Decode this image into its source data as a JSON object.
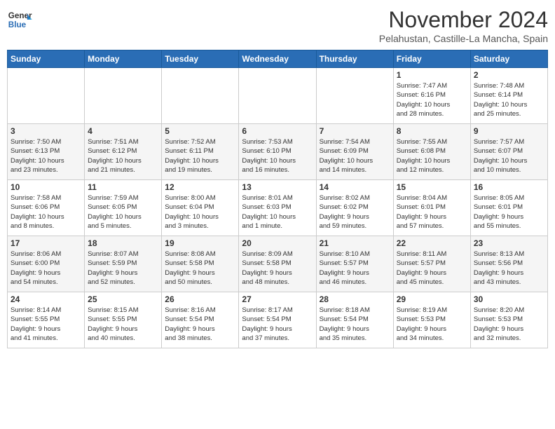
{
  "header": {
    "logo_line1": "General",
    "logo_line2": "Blue",
    "month": "November 2024",
    "location": "Pelahustan, Castille-La Mancha, Spain"
  },
  "weekdays": [
    "Sunday",
    "Monday",
    "Tuesday",
    "Wednesday",
    "Thursday",
    "Friday",
    "Saturday"
  ],
  "weeks": [
    [
      {
        "day": "",
        "info": ""
      },
      {
        "day": "",
        "info": ""
      },
      {
        "day": "",
        "info": ""
      },
      {
        "day": "",
        "info": ""
      },
      {
        "day": "",
        "info": ""
      },
      {
        "day": "1",
        "info": "Sunrise: 7:47 AM\nSunset: 6:16 PM\nDaylight: 10 hours\nand 28 minutes."
      },
      {
        "day": "2",
        "info": "Sunrise: 7:48 AM\nSunset: 6:14 PM\nDaylight: 10 hours\nand 25 minutes."
      }
    ],
    [
      {
        "day": "3",
        "info": "Sunrise: 7:50 AM\nSunset: 6:13 PM\nDaylight: 10 hours\nand 23 minutes."
      },
      {
        "day": "4",
        "info": "Sunrise: 7:51 AM\nSunset: 6:12 PM\nDaylight: 10 hours\nand 21 minutes."
      },
      {
        "day": "5",
        "info": "Sunrise: 7:52 AM\nSunset: 6:11 PM\nDaylight: 10 hours\nand 19 minutes."
      },
      {
        "day": "6",
        "info": "Sunrise: 7:53 AM\nSunset: 6:10 PM\nDaylight: 10 hours\nand 16 minutes."
      },
      {
        "day": "7",
        "info": "Sunrise: 7:54 AM\nSunset: 6:09 PM\nDaylight: 10 hours\nand 14 minutes."
      },
      {
        "day": "8",
        "info": "Sunrise: 7:55 AM\nSunset: 6:08 PM\nDaylight: 10 hours\nand 12 minutes."
      },
      {
        "day": "9",
        "info": "Sunrise: 7:57 AM\nSunset: 6:07 PM\nDaylight: 10 hours\nand 10 minutes."
      }
    ],
    [
      {
        "day": "10",
        "info": "Sunrise: 7:58 AM\nSunset: 6:06 PM\nDaylight: 10 hours\nand 8 minutes."
      },
      {
        "day": "11",
        "info": "Sunrise: 7:59 AM\nSunset: 6:05 PM\nDaylight: 10 hours\nand 5 minutes."
      },
      {
        "day": "12",
        "info": "Sunrise: 8:00 AM\nSunset: 6:04 PM\nDaylight: 10 hours\nand 3 minutes."
      },
      {
        "day": "13",
        "info": "Sunrise: 8:01 AM\nSunset: 6:03 PM\nDaylight: 10 hours\nand 1 minute."
      },
      {
        "day": "14",
        "info": "Sunrise: 8:02 AM\nSunset: 6:02 PM\nDaylight: 9 hours\nand 59 minutes."
      },
      {
        "day": "15",
        "info": "Sunrise: 8:04 AM\nSunset: 6:01 PM\nDaylight: 9 hours\nand 57 minutes."
      },
      {
        "day": "16",
        "info": "Sunrise: 8:05 AM\nSunset: 6:01 PM\nDaylight: 9 hours\nand 55 minutes."
      }
    ],
    [
      {
        "day": "17",
        "info": "Sunrise: 8:06 AM\nSunset: 6:00 PM\nDaylight: 9 hours\nand 54 minutes."
      },
      {
        "day": "18",
        "info": "Sunrise: 8:07 AM\nSunset: 5:59 PM\nDaylight: 9 hours\nand 52 minutes."
      },
      {
        "day": "19",
        "info": "Sunrise: 8:08 AM\nSunset: 5:58 PM\nDaylight: 9 hours\nand 50 minutes."
      },
      {
        "day": "20",
        "info": "Sunrise: 8:09 AM\nSunset: 5:58 PM\nDaylight: 9 hours\nand 48 minutes."
      },
      {
        "day": "21",
        "info": "Sunrise: 8:10 AM\nSunset: 5:57 PM\nDaylight: 9 hours\nand 46 minutes."
      },
      {
        "day": "22",
        "info": "Sunrise: 8:11 AM\nSunset: 5:57 PM\nDaylight: 9 hours\nand 45 minutes."
      },
      {
        "day": "23",
        "info": "Sunrise: 8:13 AM\nSunset: 5:56 PM\nDaylight: 9 hours\nand 43 minutes."
      }
    ],
    [
      {
        "day": "24",
        "info": "Sunrise: 8:14 AM\nSunset: 5:55 PM\nDaylight: 9 hours\nand 41 minutes."
      },
      {
        "day": "25",
        "info": "Sunrise: 8:15 AM\nSunset: 5:55 PM\nDaylight: 9 hours\nand 40 minutes."
      },
      {
        "day": "26",
        "info": "Sunrise: 8:16 AM\nSunset: 5:54 PM\nDaylight: 9 hours\nand 38 minutes."
      },
      {
        "day": "27",
        "info": "Sunrise: 8:17 AM\nSunset: 5:54 PM\nDaylight: 9 hours\nand 37 minutes."
      },
      {
        "day": "28",
        "info": "Sunrise: 8:18 AM\nSunset: 5:54 PM\nDaylight: 9 hours\nand 35 minutes."
      },
      {
        "day": "29",
        "info": "Sunrise: 8:19 AM\nSunset: 5:53 PM\nDaylight: 9 hours\nand 34 minutes."
      },
      {
        "day": "30",
        "info": "Sunrise: 8:20 AM\nSunset: 5:53 PM\nDaylight: 9 hours\nand 32 minutes."
      }
    ]
  ]
}
